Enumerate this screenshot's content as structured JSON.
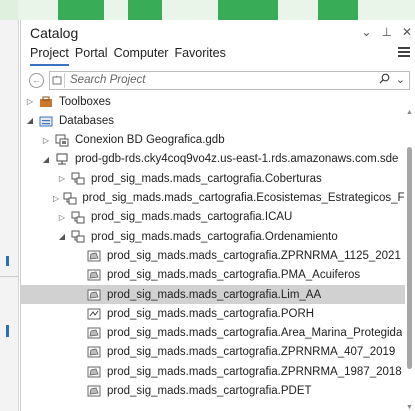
{
  "catalog": {
    "title": "Catalog",
    "controls": {
      "dropdown": "⌄",
      "pin": "⊥",
      "close": "✕"
    }
  },
  "tabs": [
    {
      "label": "Project",
      "active": true
    },
    {
      "label": "Portal",
      "active": false
    },
    {
      "label": "Computer",
      "active": false
    },
    {
      "label": "Favorites",
      "active": false
    }
  ],
  "search": {
    "placeholder": "Search Project",
    "value": ""
  },
  "tree": [
    {
      "label": "Toolboxes",
      "icon": "toolbox-icon",
      "expander": "▷",
      "indent": 0
    },
    {
      "label": "Databases",
      "icon": "databases-folder-icon",
      "expander": "◢",
      "indent": 0
    },
    {
      "label": "Conexion BD Geografica.gdb",
      "icon": "geodatabase-icon",
      "expander": "▷",
      "indent": 1
    },
    {
      "label": "prod-gdb-rds.cky4coq9vo4z.us-east-1.rds.amazonaws.com.sde",
      "icon": "database-connection-icon",
      "expander": "◢",
      "indent": 1
    },
    {
      "label": "prod_sig_mads.mads_cartografia.Coberturas",
      "icon": "feature-dataset-icon",
      "expander": "▷",
      "indent": 2
    },
    {
      "label": "prod_sig_mads.mads_cartografia.Ecosistemas_Estrategicos_Figuras_Dis",
      "icon": "feature-dataset-icon",
      "expander": "▷",
      "indent": 2
    },
    {
      "label": "prod_sig_mads.mads_cartografia.ICAU",
      "icon": "feature-dataset-icon",
      "expander": "▷",
      "indent": 2
    },
    {
      "label": "prod_sig_mads.mads_cartografia.Ordenamiento",
      "icon": "feature-dataset-icon",
      "expander": "◢",
      "indent": 2
    },
    {
      "label": "prod_sig_mads.mads_cartografia.ZPRNRMA_1125_2021",
      "icon": "polygon-feature-class-icon",
      "expander": "",
      "indent": 3
    },
    {
      "label": "prod_sig_mads.mads_cartografia.PMA_Acuiferos",
      "icon": "polygon-feature-class-icon",
      "expander": "",
      "indent": 3
    },
    {
      "label": "prod_sig_mads.mads_cartografia.Lim_AA",
      "icon": "polygon-feature-class-icon",
      "expander": "",
      "indent": 3,
      "selected": true
    },
    {
      "label": "prod_sig_mads.mads_cartografia.PORH",
      "icon": "line-feature-class-icon",
      "expander": "",
      "indent": 3
    },
    {
      "label": "prod_sig_mads.mads_cartografia.Area_Marina_Protegida",
      "icon": "polygon-feature-class-icon",
      "expander": "",
      "indent": 3
    },
    {
      "label": "prod_sig_mads.mads_cartografia.ZPRNRMA_407_2019",
      "icon": "polygon-feature-class-icon",
      "expander": "",
      "indent": 3
    },
    {
      "label": "prod_sig_mads.mads_cartografia.ZPRNRMA_1987_2018",
      "icon": "polygon-feature-class-icon",
      "expander": "",
      "indent": 3
    },
    {
      "label": "prod_sig_mads.mads_cartografia.PDET",
      "icon": "polygon-feature-class-icon",
      "expander": "",
      "indent": 3
    }
  ],
  "colors": {
    "accent": "#3a73c4",
    "selected_row": "#d1d1d1",
    "brand_green": "#2fa84f"
  }
}
